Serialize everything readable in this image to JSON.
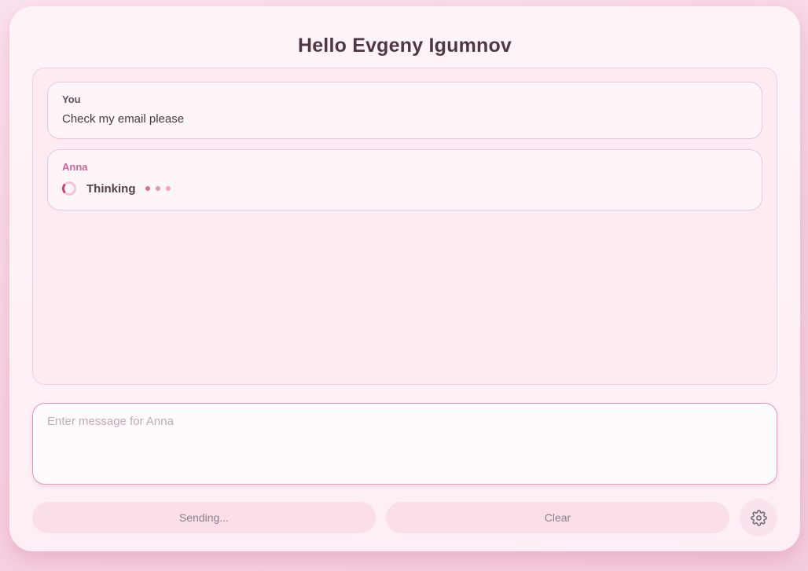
{
  "header": {
    "title": "Hello Evgeny Igumnov"
  },
  "chat": {
    "messages": [
      {
        "author": "You",
        "text": "Check my email please"
      },
      {
        "author": "Anna",
        "status_label": "Thinking",
        "status_icon": "spinner-icon",
        "typing_indicator": "three-dots"
      }
    ]
  },
  "composer": {
    "value": "",
    "placeholder": "Enter message for Anna"
  },
  "controls": {
    "send_label": "Sending...",
    "clear_label": "Clear",
    "settings_icon": "gear-icon"
  },
  "colors": {
    "page_bg": "#f7d2e2",
    "card_bg": "#fdf1f6",
    "chat_bg": "#fcebf2",
    "bubble_bg": "#fef5f9",
    "bubble_border": "#f0c4d8",
    "anna_label": "#cd6497",
    "title_text": "#4f3744",
    "spinner_accent": "#bf4379",
    "dot_pink": "#e36a9e",
    "textarea_border": "#e795ba",
    "button_bg": "#fadfe9",
    "button_text": "#8b7f88",
    "gear_icon": "#6b6770"
  }
}
